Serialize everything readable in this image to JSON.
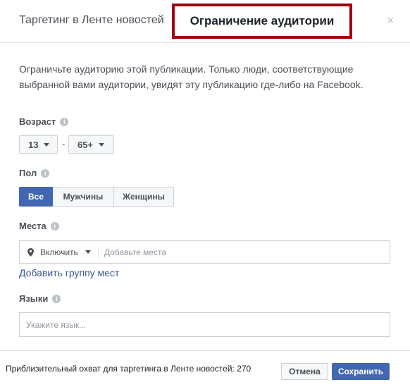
{
  "tabs": {
    "feed_targeting": "Таргетинг в Ленте новостей",
    "audience_restriction": "Ограничение аудитории"
  },
  "close_glyph": "×",
  "description": "Ограничьте аудиторию этой публикации. Только люди, соответствующие выбранной вами аудитории, увидят эту публикацию где-либо на Facebook.",
  "age": {
    "label": "Возраст",
    "min": "13",
    "separator": "-",
    "max": "65+"
  },
  "gender": {
    "label": "Пол",
    "options": [
      "Все",
      "Мужчины",
      "Женщины"
    ],
    "selected": "Все"
  },
  "places": {
    "label": "Места",
    "mode": "Включить",
    "placeholder": "Добавьте места",
    "add_group_link": "Добавить группу мест"
  },
  "languages": {
    "label": "Языки",
    "placeholder": "Укажите язык..."
  },
  "footer": {
    "reach_text": "Приблизительный охват для таргетинга в Ленте новостей: 270",
    "cancel": "Отмена",
    "save": "Сохранить"
  },
  "icons": {
    "info": "info-icon",
    "location": "location-pin-icon",
    "dropdown": "chevron-down-icon"
  },
  "colors": {
    "accent": "#4267b2",
    "link": "#365899",
    "highlight_border": "#a3000f"
  }
}
